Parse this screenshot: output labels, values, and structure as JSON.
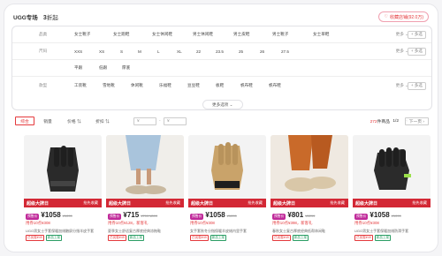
{
  "header": {
    "brand": "UGG专场",
    "count_num": "3",
    "count_suffix": "折起",
    "fav_label": "收藏店铺(92.0万)"
  },
  "filters": {
    "rows": [
      {
        "label": "品类",
        "options": [
          "女士靴子",
          "女士跑鞋",
          "女士休闲鞋",
          "男士休闲鞋",
          "男士皮鞋",
          "男士靴子",
          "女士单鞋"
        ]
      },
      {
        "label": "尺码",
        "options": [
          "XXS",
          "XS",
          "S",
          "M",
          "L",
          "XL",
          "22",
          "23.5",
          "25",
          "26",
          "27.5"
        ]
      },
      {
        "label": "",
        "options": [
          "平跟",
          "低跟",
          "厚底"
        ]
      },
      {
        "label": "款型",
        "options": [
          "工装靴",
          "雪地靴",
          "休闲靴",
          "乐福鞋",
          "豆豆鞋",
          "板鞋",
          "帆布鞋",
          "帆布鞋"
        ]
      }
    ],
    "more": "更多",
    "multi": "+ 多选",
    "more_options": "更多选项"
  },
  "sort": {
    "buttons": [
      "综合",
      "销量",
      "价格 ⇅",
      "折扣 ⇅"
    ],
    "price_from": "¥",
    "price_to": "¥",
    "range_sep": "-",
    "total": "272",
    "total_suffix": "件商品",
    "page": "1/2",
    "prev": "‹",
    "next": "下一页 ›"
  },
  "products": [
    {
      "banner": "超级大牌日",
      "banner_r": "抢先收藏",
      "tag": "预售价",
      "price": "¥1058",
      "orig": "¥1099",
      "coupon": "用券10点¥308",
      "title": "UGG男女士手套保暖加绒触屏分指羊皮手套",
      "b1": "已优惠¥49",
      "b2": "新品上架"
    },
    {
      "banner": "超级大牌日",
      "banner_r": "抢先收藏",
      "tag": "预售价",
      "price": "¥715",
      "orig": "¥799 ¥899",
      "coupon": "用券10点¥128，新客礼",
      "title": "夏季女士舒适复古厚底经典凉拖鞋",
      "b1": "已优惠¥49",
      "b2": "新品上架"
    },
    {
      "banner": "超级大牌日",
      "banner_r": "抢先收藏",
      "tag": "预售价",
      "price": "¥1058",
      "orig": "¥1099",
      "coupon": "用券10点¥308",
      "title": "女手套秋冬分指保暖羊皮绒内里手套",
      "b1": "已优惠¥49",
      "b2": "新品上架"
    },
    {
      "banner": "超级大牌日",
      "banner_r": "抢先收藏",
      "tag": "预售价",
      "price": "¥801",
      "orig": "¥1299",
      "coupon": "用券10点¥398，新客礼",
      "title": "春秋女士复古厚底经典低帮休闲鞋",
      "b1": "已优惠¥49",
      "b2": "新品上架"
    },
    {
      "banner": "超级大牌日",
      "banner_r": "抢先收藏",
      "tag": "预售价",
      "price": "¥1058",
      "orig": "¥1099",
      "coupon": "用券10点¥308",
      "title": "UGG男女士手套保暖加绒防滑手套",
      "b1": "已优惠¥49",
      "b2": "新品上架"
    }
  ]
}
